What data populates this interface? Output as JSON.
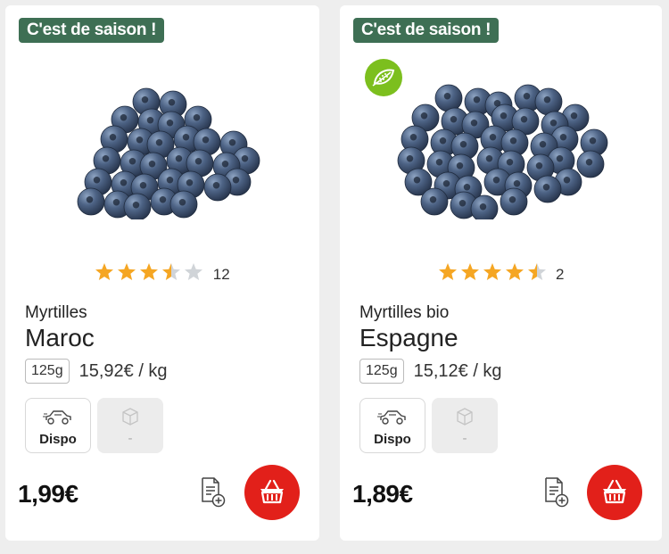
{
  "products": [
    {
      "badge": "C'est de saison !",
      "bio": false,
      "rating": 3.5,
      "review_count": "12",
      "name": "Myrtilles",
      "origin": "Maroc",
      "weight": "125g",
      "unit_price": "15,92€ / kg",
      "drive_label": "Dispo",
      "other_label": "-",
      "price": "1,99€",
      "icons": {
        "drive": "car-icon",
        "other": "box-icon",
        "list": "add-to-list-icon",
        "basket": "basket-icon"
      }
    },
    {
      "badge": "C'est de saison !",
      "bio": true,
      "rating": 4.5,
      "review_count": "2",
      "name": "Myrtilles bio",
      "origin": "Espagne",
      "weight": "125g",
      "unit_price": "15,12€ / kg",
      "drive_label": "Dispo",
      "other_label": "-",
      "price": "1,89€",
      "icons": {
        "bio": "organic-leaf-icon",
        "drive": "car-icon",
        "other": "box-icon",
        "list": "add-to-list-icon",
        "basket": "basket-icon"
      }
    }
  ],
  "colors": {
    "badge": "#3e6f54",
    "bio": "#7cbf1e",
    "star": "#f5a623",
    "star_empty": "#d0d4d8",
    "basket": "#e2201a"
  }
}
